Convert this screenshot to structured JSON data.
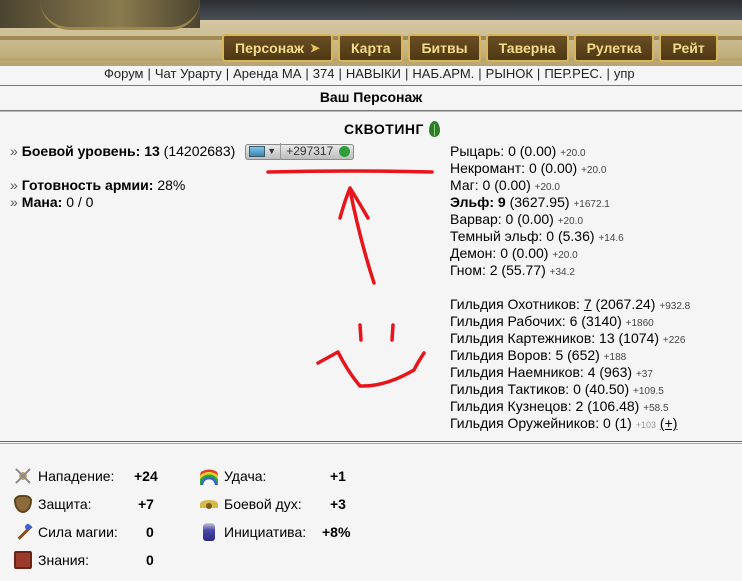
{
  "top_nav": [
    {
      "label": "Персонаж",
      "icon": "pin-icon"
    },
    {
      "label": "Карта"
    },
    {
      "label": "Битвы"
    },
    {
      "label": "Таверна"
    },
    {
      "label": "Рулетка"
    },
    {
      "label": "Рейт"
    }
  ],
  "sub_nav": [
    "Форум",
    "Чат Урарту",
    "Аренда МА",
    "374",
    "НАВЫКИ",
    "НАБ.АРМ.",
    "РЫНОК",
    "ПЕР.РЕС.",
    "упр"
  ],
  "page_title": "Ваш Персонаж",
  "character": {
    "name": "СКВОТИНГ",
    "name_icon": "leaf-icon"
  },
  "left_stats": {
    "combat_level_label": "Боевой уровень:",
    "combat_level_value": "13",
    "combat_level_exp": "(14202683)",
    "exp_widget_value": "+297317",
    "army_readiness_label": "Готовность армии:",
    "army_readiness_value": "28%",
    "mana_label": "Мана:",
    "mana_value": "0 / 0"
  },
  "factions": [
    {
      "name": "Рыцарь:",
      "level": "0",
      "points": "(0.00)",
      "bonus": "+20.0",
      "bold": false
    },
    {
      "name": "Некромант:",
      "level": "0",
      "points": "(0.00)",
      "bonus": "+20.0",
      "bold": false
    },
    {
      "name": "Маг:",
      "level": "0",
      "points": "(0.00)",
      "bonus": "+20.0",
      "bold": false
    },
    {
      "name": "Эльф:",
      "level": "9",
      "points": "(3627.95)",
      "bonus": "+1672.1",
      "bold": true
    },
    {
      "name": "Варвар:",
      "level": "0",
      "points": "(0.00)",
      "bonus": "+20.0",
      "bold": false
    },
    {
      "name": "Темный эльф:",
      "level": "0",
      "points": "(5.36)",
      "bonus": "+14.6",
      "bold": false
    },
    {
      "name": "Демон:",
      "level": "0",
      "points": "(0.00)",
      "bonus": "+20.0",
      "bold": false
    },
    {
      "name": "Гном:",
      "level": "2",
      "points": "(55.77)",
      "bonus": "+34.2",
      "bold": false
    }
  ],
  "guilds": [
    {
      "name": "Гильдия Охотников:",
      "level": "7",
      "points": "(2067.24)",
      "bonus": "+932.8",
      "underline": true
    },
    {
      "name": "Гильдия Рабочих:",
      "level": "6",
      "points": "(3140)",
      "bonus": "+1860",
      "underline": false
    },
    {
      "name": "Гильдия Картежников:",
      "level": "13",
      "points": "(1074)",
      "bonus": "+226",
      "underline": false
    },
    {
      "name": "Гильдия Воров:",
      "level": "5",
      "points": "(652)",
      "bonus": "+188",
      "underline": false
    },
    {
      "name": "Гильдия Наемников:",
      "level": "4",
      "points": "(963)",
      "bonus": "+37",
      "underline": false
    },
    {
      "name": "Гильдия Тактиков:",
      "level": "0",
      "points": "(40.50)",
      "bonus": "+109.5",
      "underline": false
    },
    {
      "name": "Гильдия Кузнецов:",
      "level": "2",
      "points": "(106.48)",
      "bonus": "+58.5",
      "underline": false
    }
  ],
  "gunsmith_guild": {
    "name": "Гильдия Оружейников:",
    "level": "0",
    "points": "(1)",
    "bonus": "+103",
    "plus_link": "(+)"
  },
  "attributes": [
    {
      "label": "Нападение:",
      "value": "+24",
      "icon": "crossed-swords-icon"
    },
    {
      "label": "Защита:",
      "value": "+7",
      "icon": "shield-icon"
    },
    {
      "label": "Сила магии:",
      "value": "0",
      "icon": "magic-wand-icon"
    },
    {
      "label": "Знания:",
      "value": "0",
      "icon": "book-icon"
    },
    {
      "label": "Удача:",
      "value": "+1",
      "icon": "rainbow-icon"
    },
    {
      "label": "Боевой дух:",
      "value": "+3",
      "icon": "wings-icon"
    },
    {
      "label": "Инициатива:",
      "value": "+8%",
      "icon": "potion-bottle-icon"
    }
  ],
  "colors": {
    "nav_bg": "#5a4119",
    "nav_text": "#f3dc8a",
    "nav_border": "#d8b45a",
    "annotation_red": "#e8141c",
    "leaf_green": "#2f7d2a"
  }
}
